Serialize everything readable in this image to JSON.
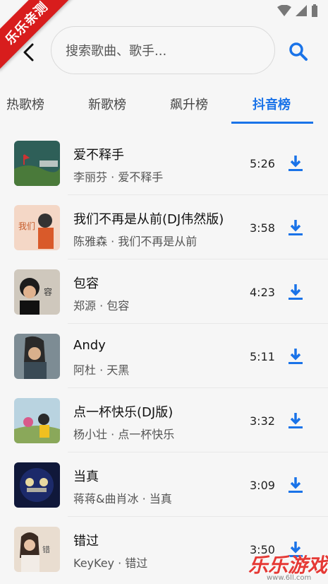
{
  "corner_badge": "乐乐亲测",
  "search": {
    "placeholder": "搜索歌曲、歌手..."
  },
  "tabs": [
    {
      "label": "热歌榜",
      "active": false
    },
    {
      "label": "新歌榜",
      "active": false
    },
    {
      "label": "飙升榜",
      "active": false
    },
    {
      "label": "抖音榜",
      "active": true
    }
  ],
  "songs": [
    {
      "title": "爱不释手",
      "subtitle": "李丽芬 · 爱不释手",
      "duration": "5:26"
    },
    {
      "title": "我们不再是从前(DJ伟然版)",
      "subtitle": "陈雅森 · 我们不再是从前",
      "duration": "3:58"
    },
    {
      "title": "包容",
      "subtitle": "郑源 · 包容",
      "duration": "4:23"
    },
    {
      "title": "Andy",
      "subtitle": "阿杜 · 天黑",
      "duration": "5:11"
    },
    {
      "title": "点一杯快乐(DJ版)",
      "subtitle": "杨小壮 · 点一杯快乐",
      "duration": "3:32"
    },
    {
      "title": "当真",
      "subtitle": "蒋蒋&曲肖冰 · 当真",
      "duration": "3:09"
    },
    {
      "title": "错过",
      "subtitle": "KeyKey · 错过",
      "duration": "3:50"
    }
  ],
  "watermark": {
    "text": "乐乐游戏",
    "url": "www.6ll.com"
  },
  "colors": {
    "accent": "#1a73e8",
    "badge": "#d81d1d"
  },
  "icons": {
    "back": "back-arrow-icon",
    "search": "search-icon",
    "download": "download-icon"
  }
}
